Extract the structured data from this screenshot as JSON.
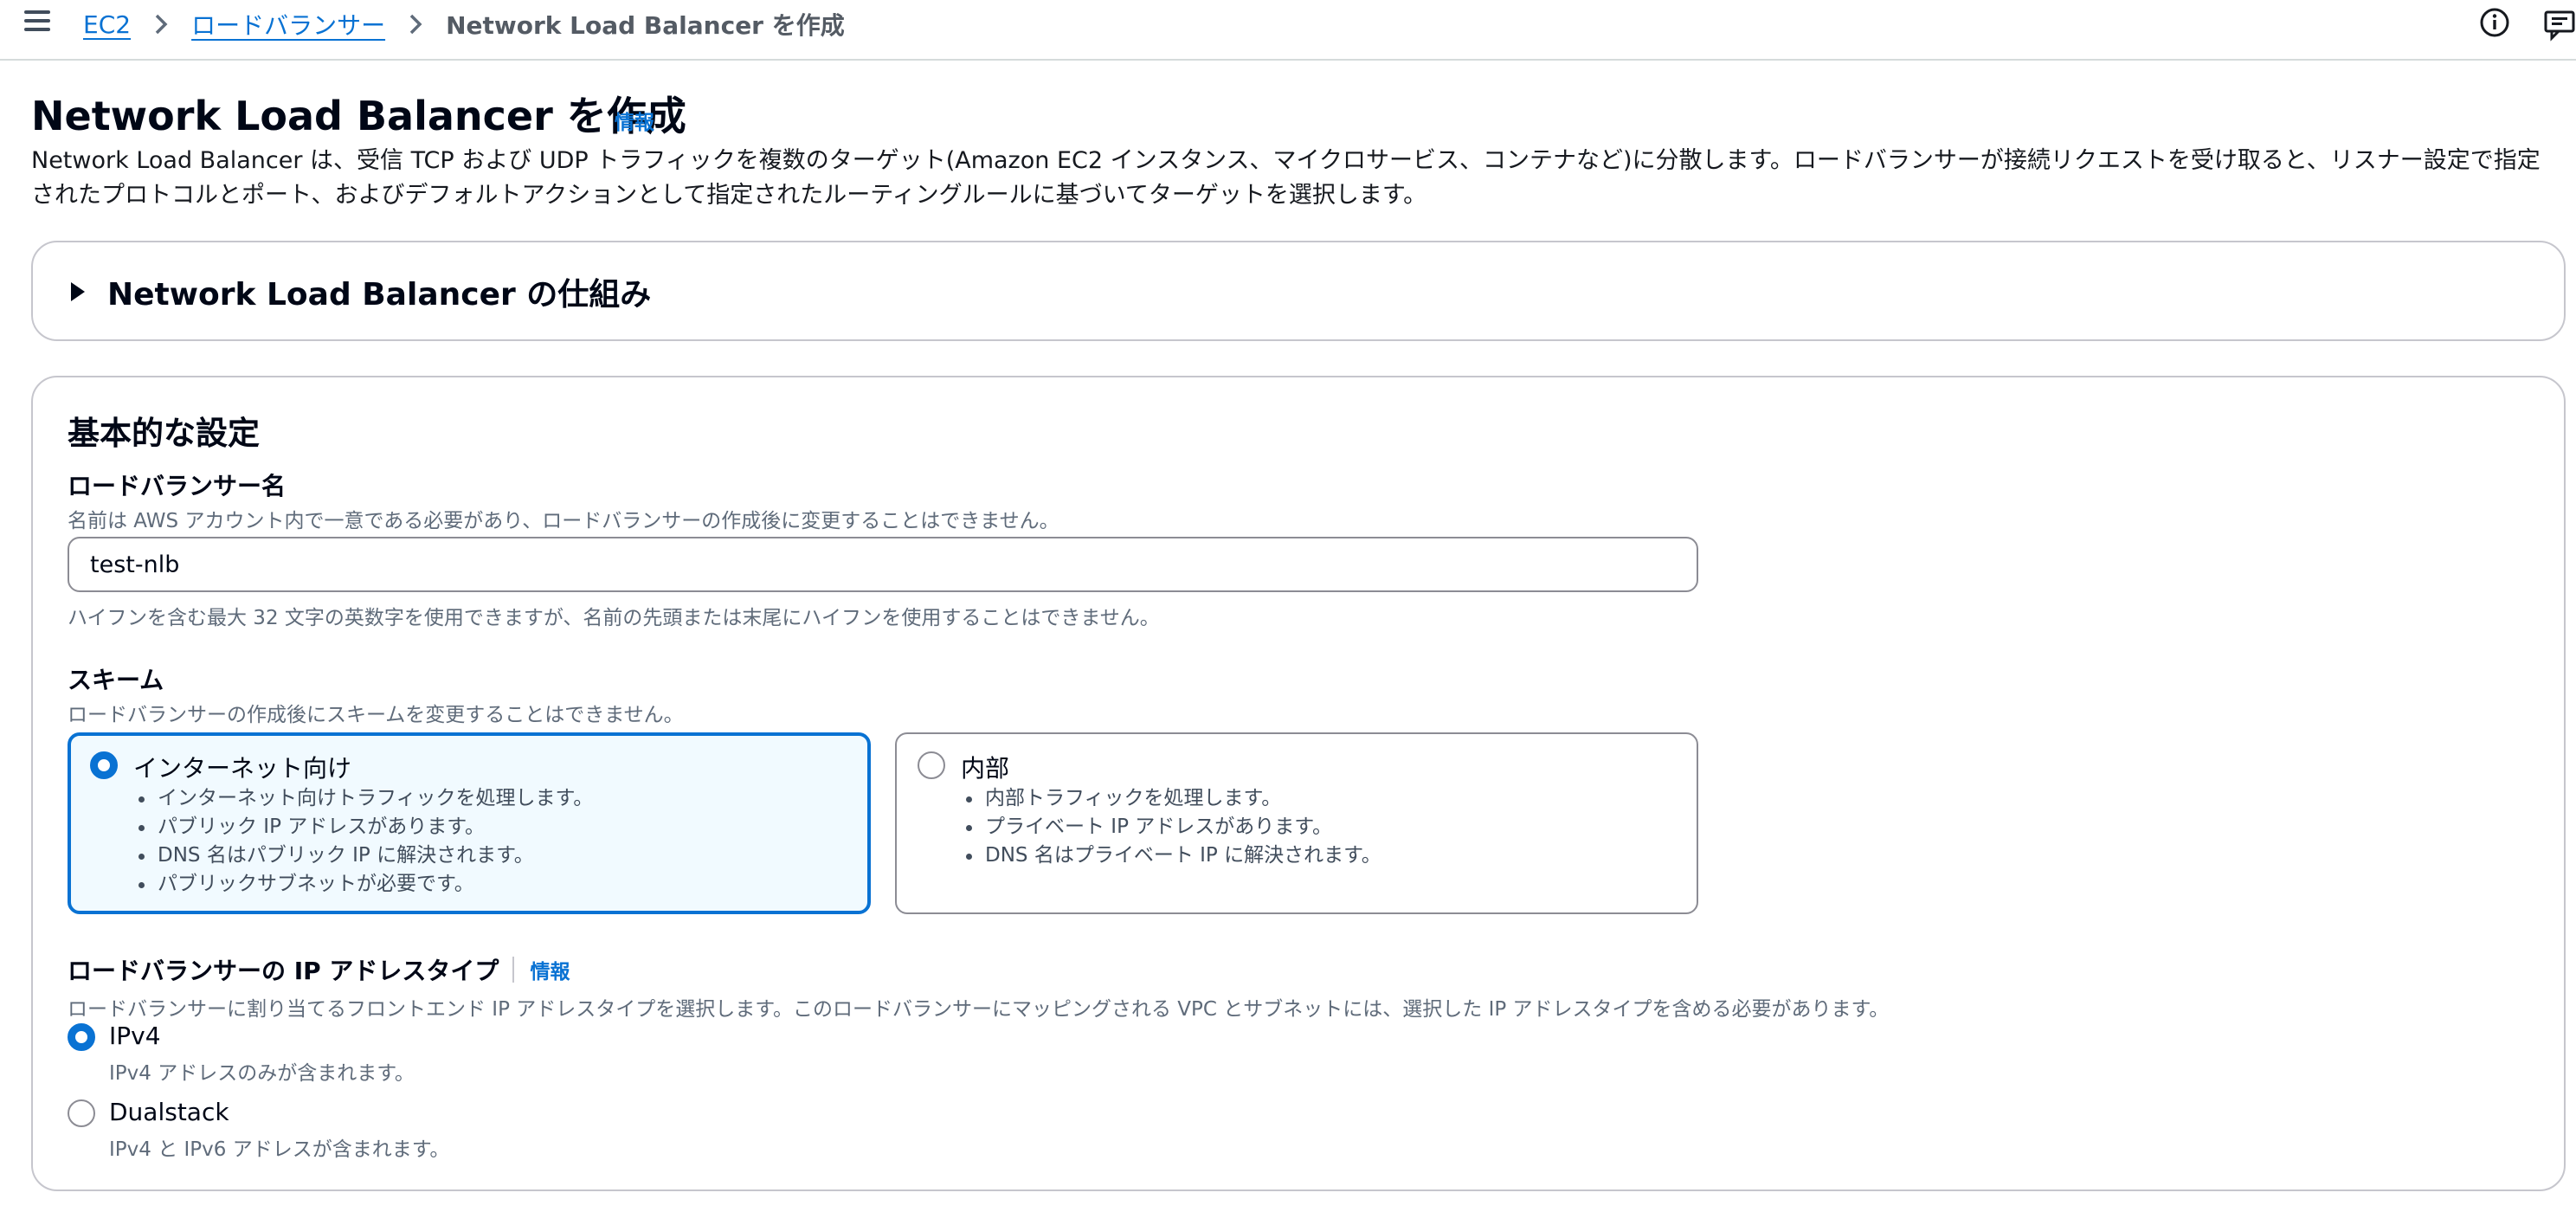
{
  "breadcrumb": {
    "items": [
      "EC2",
      "ロードバランサー"
    ],
    "current": "Network Load Balancer を作成"
  },
  "header": {
    "title": "Network Load Balancer を作成",
    "info_label": "情報",
    "description": "Network Load Balancer は、受信 TCP および UDP トラフィックを複数のターゲット(Amazon EC2 インスタンス、マイクロサービス、コンテナなど)に分散します。ロードバランサーが接続リクエストを受け取ると、リスナー設定で指定されたプロトコルとポート、およびデフォルトアクションとして指定されたルーティングルールに基づいてターゲットを選択します。"
  },
  "how_it_works": {
    "label": "Network Load Balancer の仕組み",
    "expanded": false
  },
  "basic_settings": {
    "title": "基本的な設定",
    "name_field": {
      "label": "ロードバランサー名",
      "description": "名前は AWS アカウント内で一意である必要があり、ロードバランサーの作成後に変更することはできません。",
      "value": "test-nlb",
      "constraint": "ハイフンを含む最大 32 文字の英数字を使用できますが、名前の先頭または末尾にハイフンを使用することはできません。"
    },
    "scheme": {
      "label": "スキーム",
      "description": "ロードバランサーの作成後にスキームを変更することはできません。",
      "options": [
        {
          "title": "インターネット向け",
          "selected": true,
          "bullets": [
            "インターネット向けトラフィックを処理します。",
            "パブリック IP アドレスがあります。",
            "DNS 名はパブリック IP に解決されます。",
            "パブリックサブネットが必要です。"
          ]
        },
        {
          "title": "内部",
          "selected": false,
          "bullets": [
            "内部トラフィックを処理します。",
            "プライベート IP アドレスがあります。",
            "DNS 名はプライベート IP に解決されます。"
          ]
        }
      ]
    },
    "ip_type": {
      "label": "ロードバランサーの IP アドレスタイプ",
      "info_label": "情報",
      "description": "ロードバランサーに割り当てるフロントエンド IP アドレスタイプを選択します。このロードバランサーにマッピングされる VPC とサブネットには、選択した IP アドレスタイプを含める必要があります。",
      "options": [
        {
          "label": "IPv4",
          "description": "IPv4 アドレスのみが含まれます。",
          "selected": true
        },
        {
          "label": "Dualstack",
          "description": "IPv4 と IPv6 アドレスが含まれます。",
          "selected": false
        }
      ]
    }
  },
  "icons": {
    "menu": "hamburger-menu-icon",
    "breadcrumb_separator": "chevron-right-icon",
    "info": "info-circle-icon",
    "feedback": "feedback-icon",
    "expand": "caret-right-icon"
  },
  "colors": {
    "accent": "#0972d3",
    "selected_tile_bg": "#f1faff",
    "border": "#c6c6cd",
    "muted_text": "#5f6b7a"
  }
}
